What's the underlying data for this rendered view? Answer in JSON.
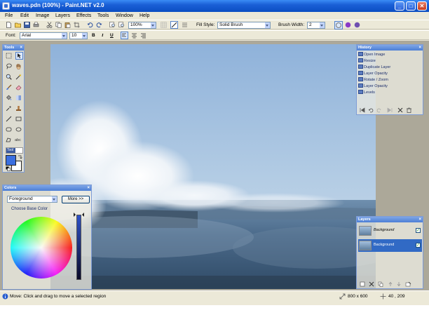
{
  "window": {
    "title": "waves.pdn (100%) - Paint.NET v2.0",
    "minimize_label": "_",
    "maximize_label": "□",
    "close_label": "✕"
  },
  "menu": [
    "File",
    "Edit",
    "Image",
    "Layers",
    "Effects",
    "Tools",
    "Window",
    "Help"
  ],
  "toolbar": {
    "zoom_value": "100%",
    "fill_style_label": "Fill Style:",
    "fill_style_value": "Solid Brush",
    "brush_width_label": "Brush Width:",
    "brush_width_value": "2",
    "font_label": "Font:",
    "font_value": "Arial",
    "font_size_value": "10",
    "bold_label": "B",
    "italic_label": "I",
    "underline_label": "U"
  },
  "tools_panel": {
    "title": "Tools",
    "text_tool_label": "abc",
    "swatch_label": "Tool"
  },
  "colors_panel": {
    "title": "Colors",
    "mode_value": "Foreground",
    "more_label": "More >>",
    "choose_label": "Choose Base Color"
  },
  "history_panel": {
    "title": "History",
    "items": [
      "Open Image",
      "Resize",
      "Duplicate Layer",
      "Layer Opacity",
      "Rotate / Zoom",
      "Layer Opacity",
      "Levels"
    ]
  },
  "layers_panel": {
    "title": "Layers",
    "layers": [
      {
        "name": "Background",
        "visible_mark": "✓"
      },
      {
        "name": "Background",
        "visible_mark": "✓"
      }
    ]
  },
  "status": {
    "message": "Move: Click and drag to move a selected region",
    "image_size": "800 x 600",
    "cursor_pos": "40 , 209"
  },
  "colors": {
    "primary": "#3a6fe0",
    "secondary": "#ffffff"
  }
}
